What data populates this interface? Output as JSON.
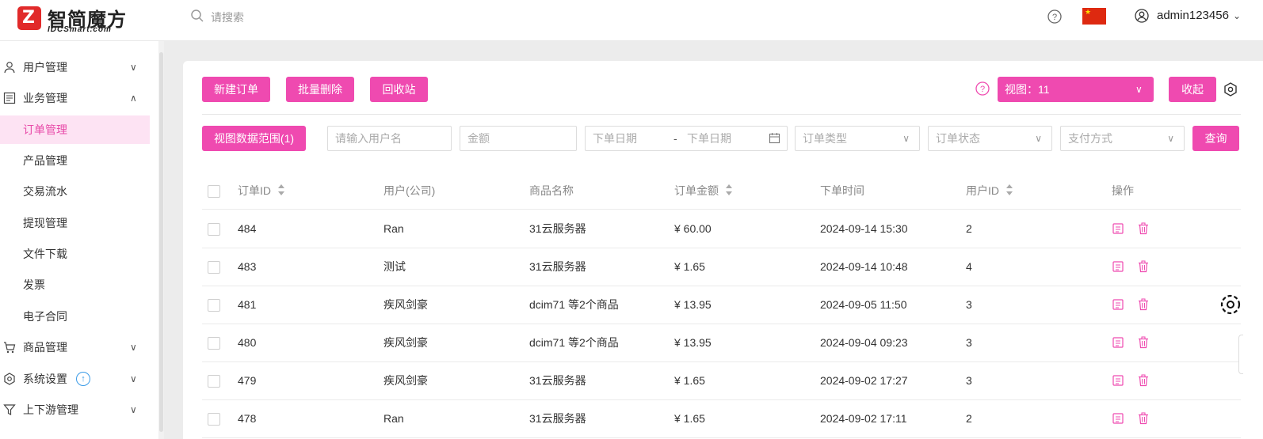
{
  "header": {
    "logo_cn": "智简魔方",
    "logo_en": "IDCSmart.com",
    "search_placeholder": "请搜索",
    "username": "admin123456",
    "brand_color": "#e12a2a"
  },
  "sidebar": {
    "items": [
      {
        "label": "用户管理",
        "icon": "user-icon",
        "expandable": true,
        "expanded": false
      },
      {
        "label": "业务管理",
        "icon": "document-icon",
        "expandable": true,
        "expanded": true
      },
      {
        "label": "订单管理",
        "active": true
      },
      {
        "label": "产品管理"
      },
      {
        "label": "交易流水"
      },
      {
        "label": "提现管理"
      },
      {
        "label": "文件下载"
      },
      {
        "label": "发票"
      },
      {
        "label": "电子合同"
      },
      {
        "label": "商品管理",
        "icon": "cart-icon",
        "expandable": true,
        "expanded": false
      },
      {
        "label": "系统设置",
        "icon": "settings-icon",
        "expandable": true,
        "expanded": false,
        "badge": "upgrade-arrow-icon"
      },
      {
        "label": "上下游管理",
        "icon": "filter-icon",
        "expandable": true,
        "expanded": false
      }
    ]
  },
  "toolbar": {
    "new_order": "新建订单",
    "batch_delete": "批量删除",
    "recycle_bin": "回收站",
    "view_label": "视图：11",
    "collapse": "收起",
    "accent_color": "#ef4ab0"
  },
  "filters": {
    "view_range": "视图数据范围(1)",
    "username_placeholder": "请输入用户名",
    "amount_placeholder": "金额",
    "date_start_placeholder": "下单日期",
    "date_separator": "-",
    "date_end_placeholder": "下单日期",
    "order_type_placeholder": "订单类型",
    "order_status_placeholder": "订单状态",
    "payment_placeholder": "支付方式",
    "query": "查询"
  },
  "table": {
    "headers": [
      "订单ID",
      "用户(公司)",
      "商品名称",
      "订单金额",
      "下单时间",
      "用户ID",
      "操作"
    ],
    "rows": [
      {
        "id": "484",
        "user": "Ran",
        "product": "31云服务器",
        "amount": "¥ 60.00",
        "time": "2024-09-14 15:30",
        "uid": "2"
      },
      {
        "id": "483",
        "user": "测试",
        "product": "31云服务器",
        "amount": "¥ 1.65",
        "time": "2024-09-14 10:48",
        "uid": "4"
      },
      {
        "id": "481",
        "user": "疾风剑豪",
        "product": "dcim71 等2个商品",
        "amount": "¥ 13.95",
        "time": "2024-09-05 11:50",
        "uid": "3"
      },
      {
        "id": "480",
        "user": "疾风剑豪",
        "product": "dcim71 等2个商品",
        "amount": "¥ 13.95",
        "time": "2024-09-04 09:23",
        "uid": "3"
      },
      {
        "id": "479",
        "user": "疾风剑豪",
        "product": "31云服务器",
        "amount": "¥ 1.65",
        "time": "2024-09-02 17:27",
        "uid": "3"
      },
      {
        "id": "478",
        "user": "Ran",
        "product": "31云服务器",
        "amount": "¥ 1.65",
        "time": "2024-09-02 17:11",
        "uid": "2"
      }
    ]
  }
}
